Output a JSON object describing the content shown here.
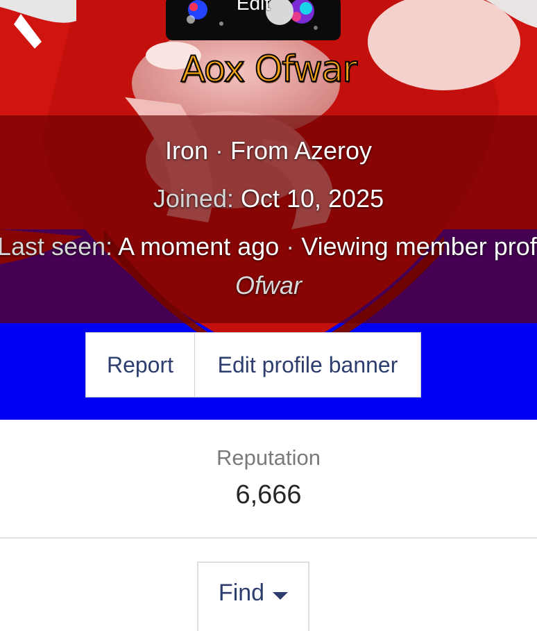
{
  "profile": {
    "avatar_edit_label": "Edit",
    "username": "Aox Ofwar",
    "rank": "Iron",
    "from": "From Azeroy",
    "joined_label": "Joined:",
    "joined_date": "Oct 10, 2025",
    "last_seen_label": "Last seen:",
    "last_seen_value": "A moment ago",
    "activity": "Viewing member profile",
    "full_name": "Ofwar",
    "separator": " · "
  },
  "actions": {
    "report_label": "Report",
    "edit_banner_label": "Edit profile banner"
  },
  "stats": {
    "reputation_label": "Reputation",
    "reputation_value": "6,666"
  },
  "find": {
    "label": "Find",
    "icon": "caret-down-icon"
  },
  "colors": {
    "username": "#f7a21b",
    "link_text": "#2d3e6e",
    "banner_blue": "#0000f2",
    "banner_red": "#c4100c"
  }
}
